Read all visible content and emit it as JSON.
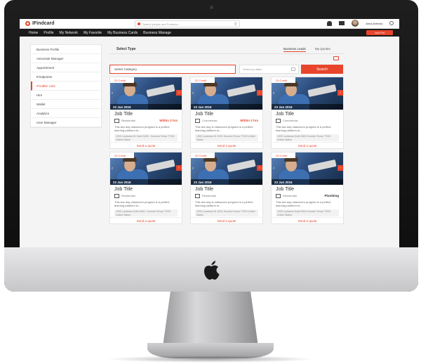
{
  "app": {
    "logo_text": "IFindcard",
    "search_placeholder": "Search people and Products...",
    "user_name": "Anna Anthina",
    "join_label": "Join Pro"
  },
  "nav": [
    "Home",
    "Profile",
    "My Network",
    "My Favorite",
    "My Business Cards",
    "Business Manage"
  ],
  "sidebar": [
    {
      "label": "Business Profile",
      "active": false
    },
    {
      "label": "Associate Manager",
      "active": false
    },
    {
      "label": "Appointment",
      "active": false
    },
    {
      "label": "IFindpoints",
      "active": false
    },
    {
      "label": "IFindBiz Lists",
      "active": true
    },
    {
      "label": "Hire",
      "active": false
    },
    {
      "label": "Wallet",
      "active": false
    },
    {
      "label": "Analytics",
      "active": false
    },
    {
      "label": "User Manager",
      "active": false
    }
  ],
  "main": {
    "select_type": "Select Type",
    "tabs": [
      "Business Leads",
      "My Quotes"
    ],
    "category_placeholder": "Select Category",
    "dates_placeholder": "Select by dates",
    "search_label": "Search"
  },
  "cards": [
    {
      "badge": "20 Credit",
      "date": "23 Jun 2016",
      "title": "Job Title",
      "category": "Residential",
      "tag": "Within 2 hrs",
      "tag_style": "accent",
      "desc": "This two day classroom program is a perfect learning platform to...",
      "address": "1000 Louisiana St. Suite 5400 - Houston Texas 77002 United States",
      "cta": "Send a quote"
    },
    {
      "badge": "20 Credit",
      "date": "23 Jun 2016",
      "title": "Job Title",
      "category": "Commercial",
      "tag": "Within 2 hrs",
      "tag_style": "accent",
      "desc": "This two day is classroom program is a perfect learning platform to...",
      "address": "1000 Louisiana St. 5210 Houston Texas 77002 United States",
      "cta": "Send a quote"
    },
    {
      "badge": "20 Credit",
      "date": "23 Jun 2016",
      "title": "Job Title",
      "category": "Commercial",
      "tag": "",
      "tag_style": "accent",
      "desc": "This two day classroom program is a perfect learning platform to...",
      "address": "1000 Louisiana Suite 5400 Houston Texas 77002 United States",
      "cta": "Send a quote"
    },
    {
      "badge": "20 Credit",
      "date": "23 Jun 2016",
      "title": "Job Title",
      "category": "Residential",
      "tag": "",
      "tag_style": "accent",
      "desc": "This two day classroom program is a perfect learning platform to...",
      "address": "1000 Louisiana Suite 5400 - Houston Texas 77002 United States",
      "cta": "Send a quote"
    },
    {
      "badge": "20 Credit",
      "date": "23 Jun 2016",
      "title": "Job Title",
      "category": "Residential",
      "tag": "",
      "tag_style": "accent",
      "desc": "This two day is classroom program is a perfect learning platform to...",
      "address": "1000 Louisiana St. 5210 Houston Texas 77002 United States",
      "cta": "Send a quote"
    },
    {
      "badge": "20 Credit",
      "date": "23 Jun 2016",
      "title": "Job Title",
      "category": "Residential",
      "tag": "Plumbing",
      "tag_style": "dark",
      "desc": "This two day classroom program is a perfect learning platform to...",
      "address": "1000 Louisiana Suite 5400 Houston Texas 77002 United States",
      "cta": "Send a quote"
    }
  ],
  "colors": {
    "accent": "#e8452c",
    "nav_bg": "#1b1b1b"
  }
}
